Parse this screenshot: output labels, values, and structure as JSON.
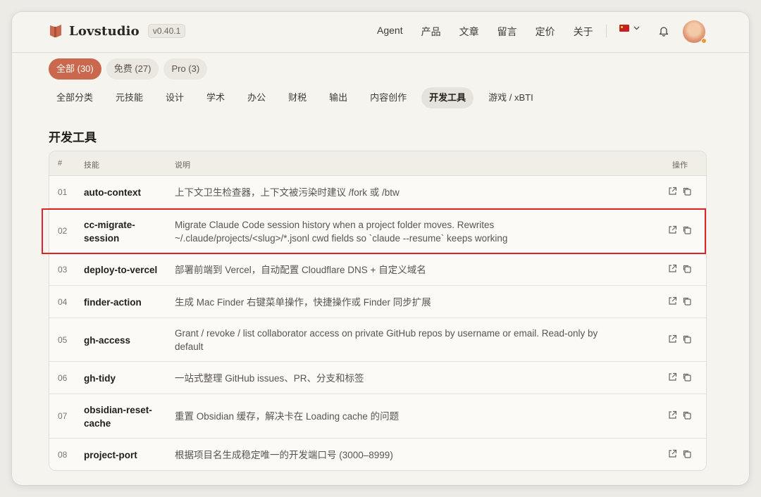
{
  "brand": {
    "name": "Lovstudio",
    "version": "v0.40.1"
  },
  "nav": [
    "Agent",
    "产品",
    "文章",
    "留言",
    "定价",
    "关于"
  ],
  "pills": [
    {
      "label": "全部 (30)",
      "active": true
    },
    {
      "label": "免费 (27)",
      "active": false
    },
    {
      "label": "Pro (3)",
      "active": false
    }
  ],
  "categories": [
    {
      "label": "全部分类",
      "active": false
    },
    {
      "label": "元技能",
      "active": false
    },
    {
      "label": "设计",
      "active": false
    },
    {
      "label": "学术",
      "active": false
    },
    {
      "label": "办公",
      "active": false
    },
    {
      "label": "财税",
      "active": false
    },
    {
      "label": "输出",
      "active": false
    },
    {
      "label": "内容创作",
      "active": false
    },
    {
      "label": "开发工具",
      "active": true
    },
    {
      "label": "游戏 / xBTI",
      "active": false
    }
  ],
  "section_title": "开发工具",
  "table": {
    "headers": {
      "num": "#",
      "skill": "技能",
      "desc": "说明",
      "actions": "操作"
    },
    "rows": [
      {
        "num": "01",
        "name": "auto-context",
        "desc": "上下文卫生检查器，上下文被污染时建议 /fork 或 /btw"
      },
      {
        "num": "02",
        "name": "cc-migrate-session",
        "desc": "Migrate Claude Code session history when a project folder moves. Rewrites ~/.claude/projects/<slug>/*.jsonl cwd fields so `claude --resume` keeps working",
        "highlighted": true
      },
      {
        "num": "03",
        "name": "deploy-to-vercel",
        "desc": "部署前端到 Vercel，自动配置 Cloudflare DNS + 自定义域名"
      },
      {
        "num": "04",
        "name": "finder-action",
        "desc": "生成 Mac Finder 右键菜单操作，快捷操作或 Finder 同步扩展"
      },
      {
        "num": "05",
        "name": "gh-access",
        "desc": "Grant / revoke / list collaborator access on private GitHub repos by username or email. Read-only by default"
      },
      {
        "num": "06",
        "name": "gh-tidy",
        "desc": "一站式整理 GitHub issues、PR、分支和标签"
      },
      {
        "num": "07",
        "name": "obsidian-reset-cache",
        "desc": "重置 Obsidian 缓存，解决卡在 Loading cache 的问题"
      },
      {
        "num": "08",
        "name": "project-port",
        "desc": "根据项目名生成稳定唯一的开发端口号 (3000–8999)"
      }
    ]
  },
  "icons": {
    "open": "external-link-icon",
    "copy": "copy-icon",
    "bell": "bell-icon",
    "lang": "china-flag-icon"
  },
  "colors": {
    "accent": "#c9684c",
    "highlight": "#d8262b"
  }
}
